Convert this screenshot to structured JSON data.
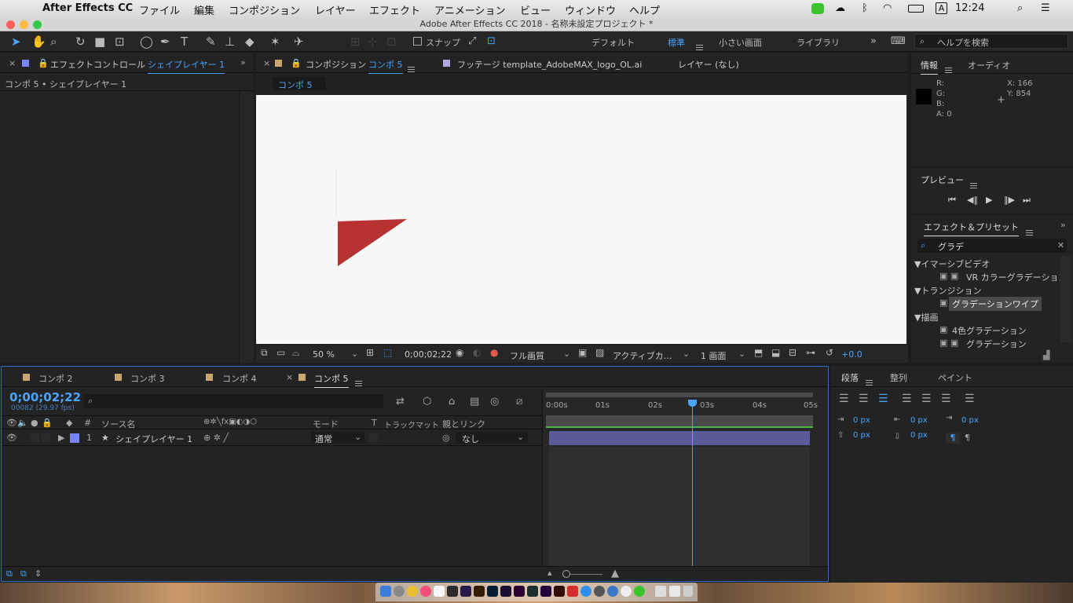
{
  "menubar": {
    "app": "After Effects CC",
    "items": [
      "ファイル",
      "編集",
      "コンポジション",
      "レイヤー",
      "エフェクト",
      "アニメーション",
      "ビュー",
      "ウィンドウ",
      "ヘルプ"
    ],
    "clock": "12:24",
    "input_method": "A"
  },
  "window": {
    "title": "Adobe After Effects CC 2018 - 名称未設定プロジェクト *"
  },
  "toolbar": {
    "snap_label": "スナップ",
    "workspaces": [
      "デフォルト",
      "標準",
      "小さい画面",
      "ライブラリ"
    ],
    "active_workspace": "標準",
    "search_placeholder": "ヘルプを検索"
  },
  "effect_controls": {
    "tab_label": "エフェクトコントロール",
    "layer": "シェイプレイヤー 1",
    "breadcrumb": "コンポ 5 • シェイプレイヤー 1"
  },
  "viewer": {
    "comp_tab_prefix": "コンポジション",
    "comp_name": "コンポ 5",
    "footage_tab": "フッテージ template_AdobeMAX_logo_OL.ai",
    "layer_tab": "レイヤー (なし)",
    "subtab": "コンポ 5",
    "zoom": "50 %",
    "timecode": "0;00;02;22",
    "quality": "フル画質",
    "camera": "アクティブカ...",
    "views": "1 画面",
    "exposure": "+0.0",
    "shape_color": "#b83232"
  },
  "info": {
    "tab": "情報",
    "audio_tab": "オーディオ",
    "r": "R:",
    "g": "G:",
    "b": "B:",
    "a": "A: 0",
    "x": "X: 166",
    "y": "Y: 854"
  },
  "preview": {
    "title": "プレビュー"
  },
  "effects_presets": {
    "title": "エフェクト＆プリセット",
    "search_value": "グラデ",
    "groups": [
      {
        "name": "▼イマーシブビデオ",
        "items": [
          "VR カラーグラデーション"
        ]
      },
      {
        "name": "▼トランジション",
        "items": [
          "グラデーションワイプ"
        ]
      },
      {
        "name": "▼描画",
        "items": [
          "4色グラデーション",
          "グラデーション"
        ]
      }
    ]
  },
  "timeline": {
    "tabs": [
      "コンポ 2",
      "コンポ 3",
      "コンポ 4",
      "コンポ 5"
    ],
    "active_tab": "コンポ 5",
    "timecode": "0;00;02;22",
    "frame_info": "00082 (29.97 fps)",
    "headers": {
      "source": "ソース名",
      "mode": "モード",
      "t": "T",
      "trackmatte": "トラックマット",
      "parent": "親とリンク"
    },
    "layer": {
      "num": "1",
      "name": "シェイプレイヤー 1",
      "mode": "通常",
      "parent": "なし"
    },
    "ruler": [
      "0:00s",
      "01s",
      "02s",
      "03s",
      "04s",
      "05s"
    ],
    "playhead_seconds": 2.73,
    "duration_seconds": 5
  },
  "paragraph": {
    "tabs": [
      "段落",
      "整列",
      "ペイント"
    ],
    "values": [
      "0 px",
      "0 px",
      "0 px",
      "0 px",
      "0 px"
    ]
  },
  "colors": {
    "accent": "#4aa5ff",
    "layer_bar": "#5b5b9a",
    "label": "#7b82ff"
  }
}
